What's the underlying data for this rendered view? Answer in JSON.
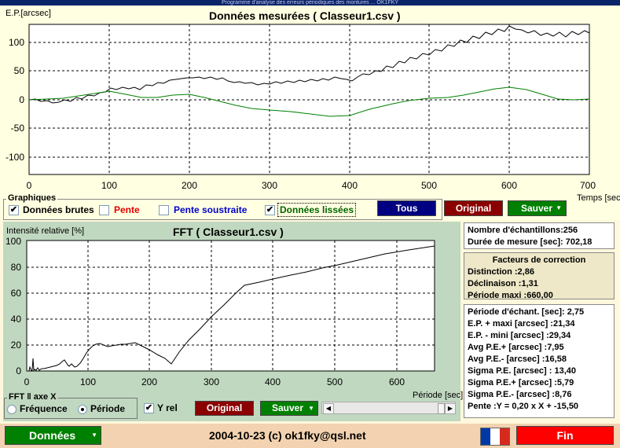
{
  "window": {
    "title": "Programme d'analyse des erreurs périodiques des montures ... OK1FKY"
  },
  "top_chart": {
    "ylabel": "E.P.[arcsec]",
    "title": "Données mesurées ( Classeur1.csv )",
    "xlabel": "Temps [sec]",
    "yticks": [
      "100",
      "50",
      "0",
      "-50",
      "-100"
    ],
    "xticks": [
      "0",
      "100",
      "200",
      "300",
      "400",
      "500",
      "600",
      "700"
    ]
  },
  "graphiques": {
    "legend": "Graphiques",
    "brutes": {
      "label": "Données brutes",
      "checked": true
    },
    "pente": {
      "label": "Pente",
      "checked": false
    },
    "soustraite": {
      "label": "Pente soustraite",
      "checked": false
    },
    "lissees": {
      "label": "Données lissées",
      "checked": true
    }
  },
  "buttons": {
    "tous": "Tous",
    "original": "Original",
    "sauver": "Sauver",
    "original2": "Original",
    "sauver2": "Sauver",
    "donnees": "Données",
    "fin": "Fin"
  },
  "fft_chart": {
    "ylabel": "Intensité relative [%]",
    "title": "FFT ( Classeur1.csv )",
    "xlabel": "Période [sec]",
    "yticks": [
      "100",
      "80",
      "60",
      "40",
      "20",
      "0"
    ],
    "xticks": [
      "0",
      "100",
      "200",
      "300",
      "400",
      "500",
      "600"
    ]
  },
  "fft_axis": {
    "legend": "FFT ‖ axe X",
    "frequence": "Fréquence",
    "periode": "Période",
    "selected": "Période"
  },
  "yrel": {
    "label": "Y rel",
    "checked": true
  },
  "stats1": {
    "samples": "Nombre d'échantillons:256",
    "duration": "Durée de mesure [sec]: 702,18"
  },
  "corrections": {
    "title": "Facteurs de correction",
    "distinction": "Distinction :2,86",
    "declinaison": "Déclinaison :1,31",
    "periode_maxi": "Période maxi :660,00"
  },
  "stats2": [
    "Période d'échant. [sec]: 2,75",
    "E.P. + maxi [arcsec] :21,34",
    "E.P. - mini [arcsec] :29,34",
    "Avg P.E.+ [arcsec] :7,95",
    "Avg P.E.- [arcsec] :16,58",
    "Sigma P.E. [arcsec] : 13,40",
    "Sigma P.E.+ [arcsec] :5,79",
    "Sigma P.E.- [arcsec] :8,76",
    "Pente :Y = 0,20 x X + -15,50"
  ],
  "footer": {
    "credit": "2004-10-23 (c) ok1fky@qsl.net"
  },
  "colors": {
    "raw": "#000000",
    "smooth": "#008000",
    "tous": "#000080",
    "original": "#8b0000",
    "sauver": "#008000",
    "fin": "#ff0000"
  }
}
